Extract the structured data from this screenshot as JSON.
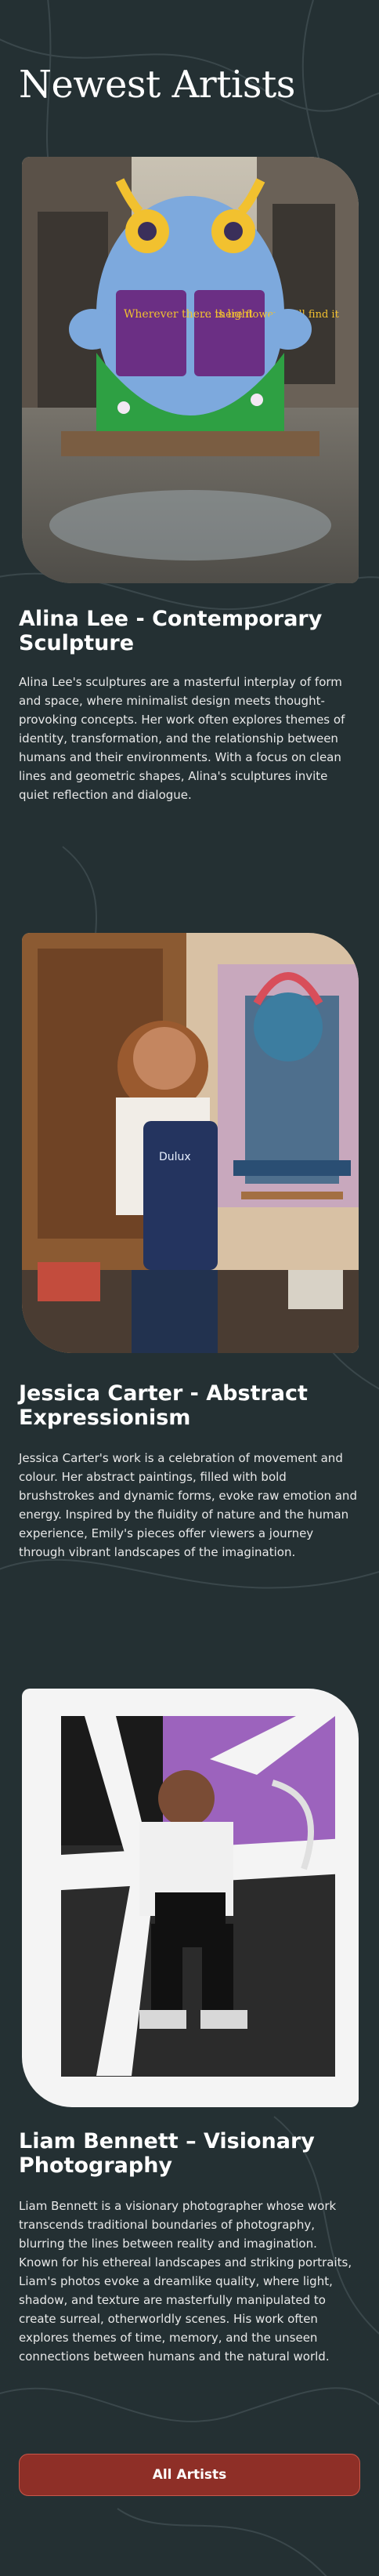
{
  "page": {
    "title": "Newest Artists"
  },
  "artists": [
    {
      "name": "Alina Lee - Contemporary Sculpture",
      "bio": "Alina Lee's sculptures are a masterful interplay of form and space, where minimalist design meets thought-provoking concepts. Her work often explores themes of identity, transformation, and the relationship between humans and their environments. With a focus on clean lines and geometric shapes, Alina's sculptures invite quiet reflection and dialogue.",
      "image": {
        "book_left_text": "Wherever there is light",
        "book_right_text": "... there flowers will find it"
      }
    },
    {
      "name": "Jessica Carter - Abstract Expressionism",
      "bio": "Jessica Carter's work is a celebration of movement and colour. Her abstract paintings, filled with bold brushstrokes and dynamic forms, evoke raw emotion and energy. Inspired by the fluidity of nature and the human experience, Emily's pieces offer viewers a journey through vibrant landscapes of the imagination.",
      "image": {
        "apron_text": "Dulux"
      }
    },
    {
      "name": "Liam Bennett – Visionary Photography",
      "bio": "Liam Bennett is a visionary photographer whose work transcends traditional boundaries of photography, blurring the lines between reality and imagination. Known for his ethereal landscapes and striking portraits, Liam's photos evoke a dreamlike quality, where light, shadow, and texture are masterfully manipulated to create surreal, otherworldly scenes. His work often explores themes of time, memory, and the unseen connections between humans and the natural world."
    }
  ],
  "actions": {
    "all_artists_label": "All Artists"
  },
  "colors": {
    "background": "#243033",
    "button_fill": "#8e2f27",
    "button_border": "#c9574a",
    "text": "#ffffff"
  }
}
